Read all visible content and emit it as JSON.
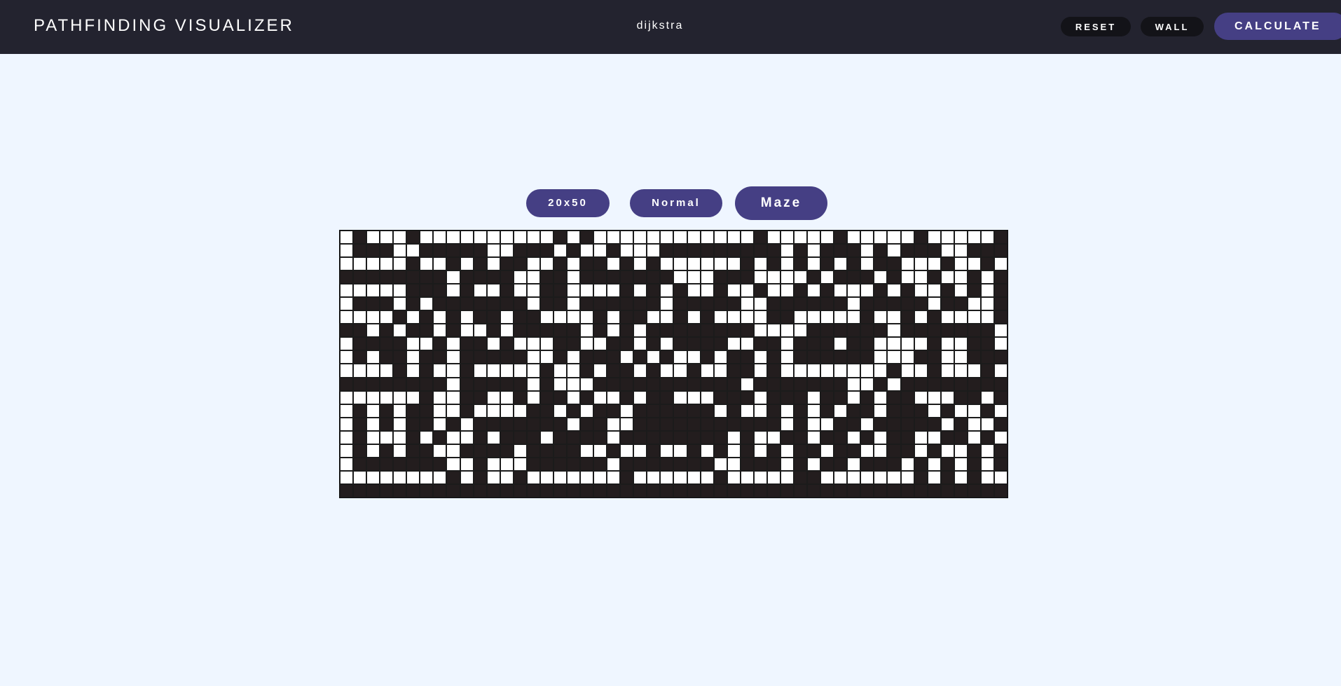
{
  "header": {
    "title": "PATHFINDING VISUALIZER",
    "algorithm": "dijkstra",
    "reset_label": "RESET",
    "wall_label": "WALL",
    "calculate_label": "CALCULATE"
  },
  "controls": {
    "grid_size_label": "20x50",
    "speed_label": "Normal",
    "maze_label": "Maze"
  },
  "grid": {
    "rows": 20,
    "cols": 50,
    "cells": [
      "0100010000000000101000000000000100000100000100000111",
      "0111001111100111010010001111111110101110101110011101",
      "0000010010101100101101010000001010101010110001001001",
      "1111111101111001101111111000111000010111010010010101",
      "0000011101001001100001010100100100101000101001010101",
      "0111010111111101101111110111110011111101111101100111",
      "0000101010110110000101100101000011000001001010000101",
      "1101011010010111110101011111111000011111101111111011",
      "0111100101101000110011010111100110111011000010011001",
      "0101101101111100101110101001011010111111000110011111",
      "0000101001000001001011010010011010000000010010001000",
      "1111111101111101000111111111110111111100101111111101",
      "0000001001100101101001011000111011101101011000110101",
      "0101011001000011010110111111010010101011011101001011",
      "0101011010111111101100111111111110100110111110100101",
      "0100010100101110111101111111101001101101011001101001",
      "0101011001111011110010010010101010110110011010010101",
      "0111111100100011111101111111001110101101110101010101",
      "0000000010100100000001000000100000110000000101010001",
      "1111111111111111111111111111111111111111111111111111"
    ]
  }
}
